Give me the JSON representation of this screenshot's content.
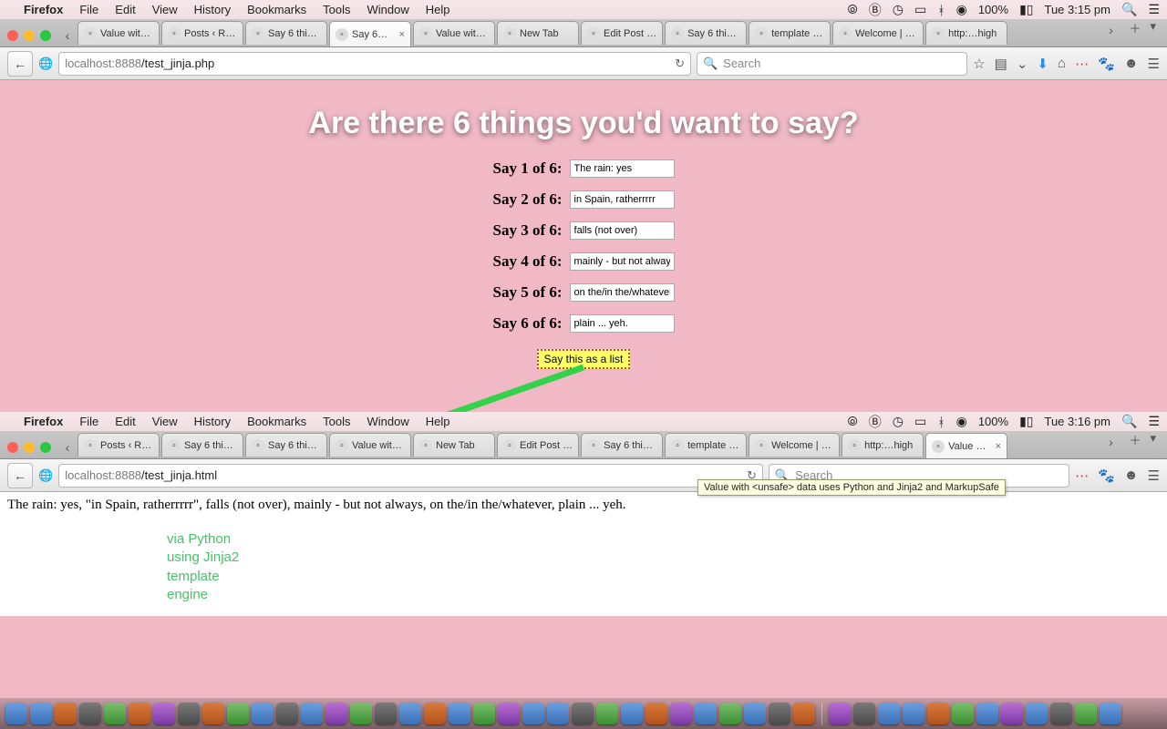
{
  "menubar1": {
    "app": "Firefox",
    "items": [
      "File",
      "Edit",
      "View",
      "History",
      "Bookmarks",
      "Tools",
      "Window",
      "Help"
    ],
    "battery": "100%",
    "clock": "Tue 3:15 pm"
  },
  "menubar2": {
    "app": "Firefox",
    "items": [
      "File",
      "Edit",
      "View",
      "History",
      "Bookmarks",
      "Tools",
      "Window",
      "Help"
    ],
    "battery": "100%",
    "clock": "Tue 3:16 pm"
  },
  "tabs1": [
    "Value wit…",
    "Posts ‹ R…",
    "Say 6 thi…",
    "Say 6…",
    "Value wit…",
    "New Tab",
    "Edit Post …",
    "Say 6 thi…",
    "template …",
    "Welcome | Ji…",
    "http:…high"
  ],
  "tabs1_active_index": 3,
  "tabs2": [
    "Posts ‹ R…",
    "Say 6 thi…",
    "Say 6 thi…",
    "Value wit…",
    "New Tab",
    "Edit Post …",
    "Say 6 thi…",
    "template …",
    "Welcome | Ji…",
    "http:…high",
    "Value …"
  ],
  "tabs2_active_index": 10,
  "url1": {
    "host": "localhost",
    "port": ":8888",
    "path": "/test_jinja.php"
  },
  "url2": {
    "host": "localhost",
    "port": ":8888",
    "path": "/test_jinja.html"
  },
  "search_placeholder": "Search",
  "page": {
    "heading": "Are there 6 things you'd want to say?",
    "rows": [
      {
        "label": "Say 1 of 6:",
        "value": "The rain: yes"
      },
      {
        "label": "Say 2 of 6:",
        "value": "in Spain, ratherrrrr"
      },
      {
        "label": "Say 3 of 6:",
        "value": "falls (not over)"
      },
      {
        "label": "Say 4 of 6:",
        "value": "mainly - but not always"
      },
      {
        "label": "Say 5 of 6:",
        "value": "on the/in the/whatever"
      },
      {
        "label": "Say 6 of 6:",
        "value": "plain ... yeh."
      }
    ],
    "submit": "Say this as a list"
  },
  "output_line": "The rain: yes, \"in Spain, ratherrrrr\", falls (not over), mainly - but not always, on the/in the/whatever, plain ... yeh.",
  "annotation": [
    "via Python",
    "using Jinja2",
    "template",
    "engine"
  ],
  "tooltip": "Value with <unsafe> data uses Python and Jinja2 and MarkupSafe"
}
